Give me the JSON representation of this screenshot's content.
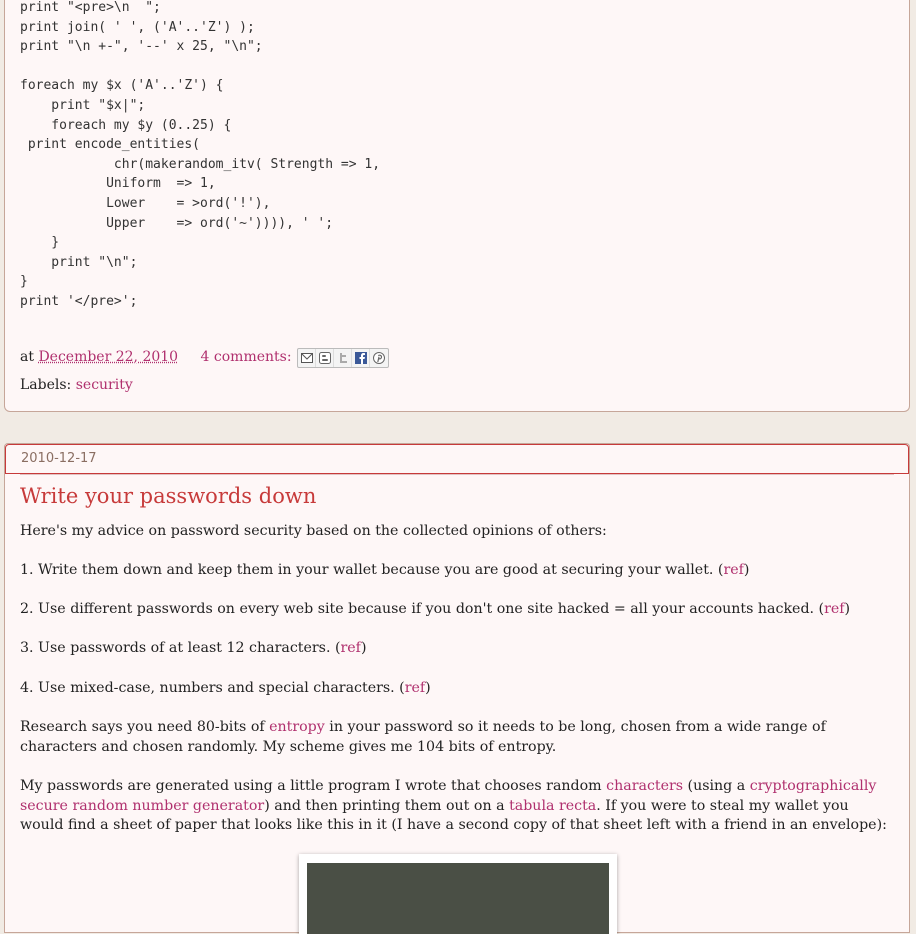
{
  "post1": {
    "code": "print \"<pre>\\n  \";\nprint join( ' ', ('A'..'Z') );\nprint \"\\n +-\", '--' x 25, \"\\n\";\n\nforeach my $x ('A'..'Z') {\n    print \"$x|\";\n    foreach my $y (0..25) {\n print encode_entities(\n            chr(makerandom_itv( Strength => 1,\n           Uniform  => 1,\n           Lower    = >ord('!'),\n           Upper    => ord('~')))), ' ';\n    }\n    print \"\\n\";\n}\nprint '</pre>';",
    "at_label": "at",
    "date_link": "December 22, 2010",
    "comments_link": "4 comments:",
    "labels_prefix": "Labels:",
    "label_link": "security"
  },
  "post2": {
    "date_header": "2010-12-17",
    "title": "Write your passwords down",
    "intro": "Here's my advice on password security based on the collected opinions of others:",
    "items": [
      {
        "text": "1. Write them down and keep them in your wallet because you are good at securing your wallet. (",
        "link": "ref",
        "end": ")"
      },
      {
        "text": "2. Use different passwords on every web site because if you don't one site hacked = all your accounts hacked. (",
        "link": "ref",
        "end": ")"
      },
      {
        "text": "3. Use passwords of at least 12 characters. (",
        "link": "ref",
        "end": ")"
      },
      {
        "text": "4. Use mixed-case, numbers and special characters. (",
        "link": "ref",
        "end": ")"
      }
    ],
    "research": {
      "pre": "Research says you need 80-bits of ",
      "link": "entropy",
      "post": " in your password so it needs to be long, chosen from a wide range of characters and chosen randomly. My scheme gives me 104 bits of entropy."
    },
    "generated": {
      "t1": "My passwords are generated using a little program I wrote that chooses random ",
      "l1": "characters",
      "t2": " (using a ",
      "l2": "cryptographically secure random number generator",
      "t3": ") and then printing them out on a ",
      "l3": "tabula recta",
      "t4": ". If you were to steal my wallet you would find a sheet of paper that looks like this in it (I have a second copy of that sheet left with a friend in an envelope):"
    }
  },
  "share_icons": [
    "email-icon",
    "blogger-icon",
    "twitter-icon",
    "facebook-icon",
    "pinterest-icon"
  ]
}
